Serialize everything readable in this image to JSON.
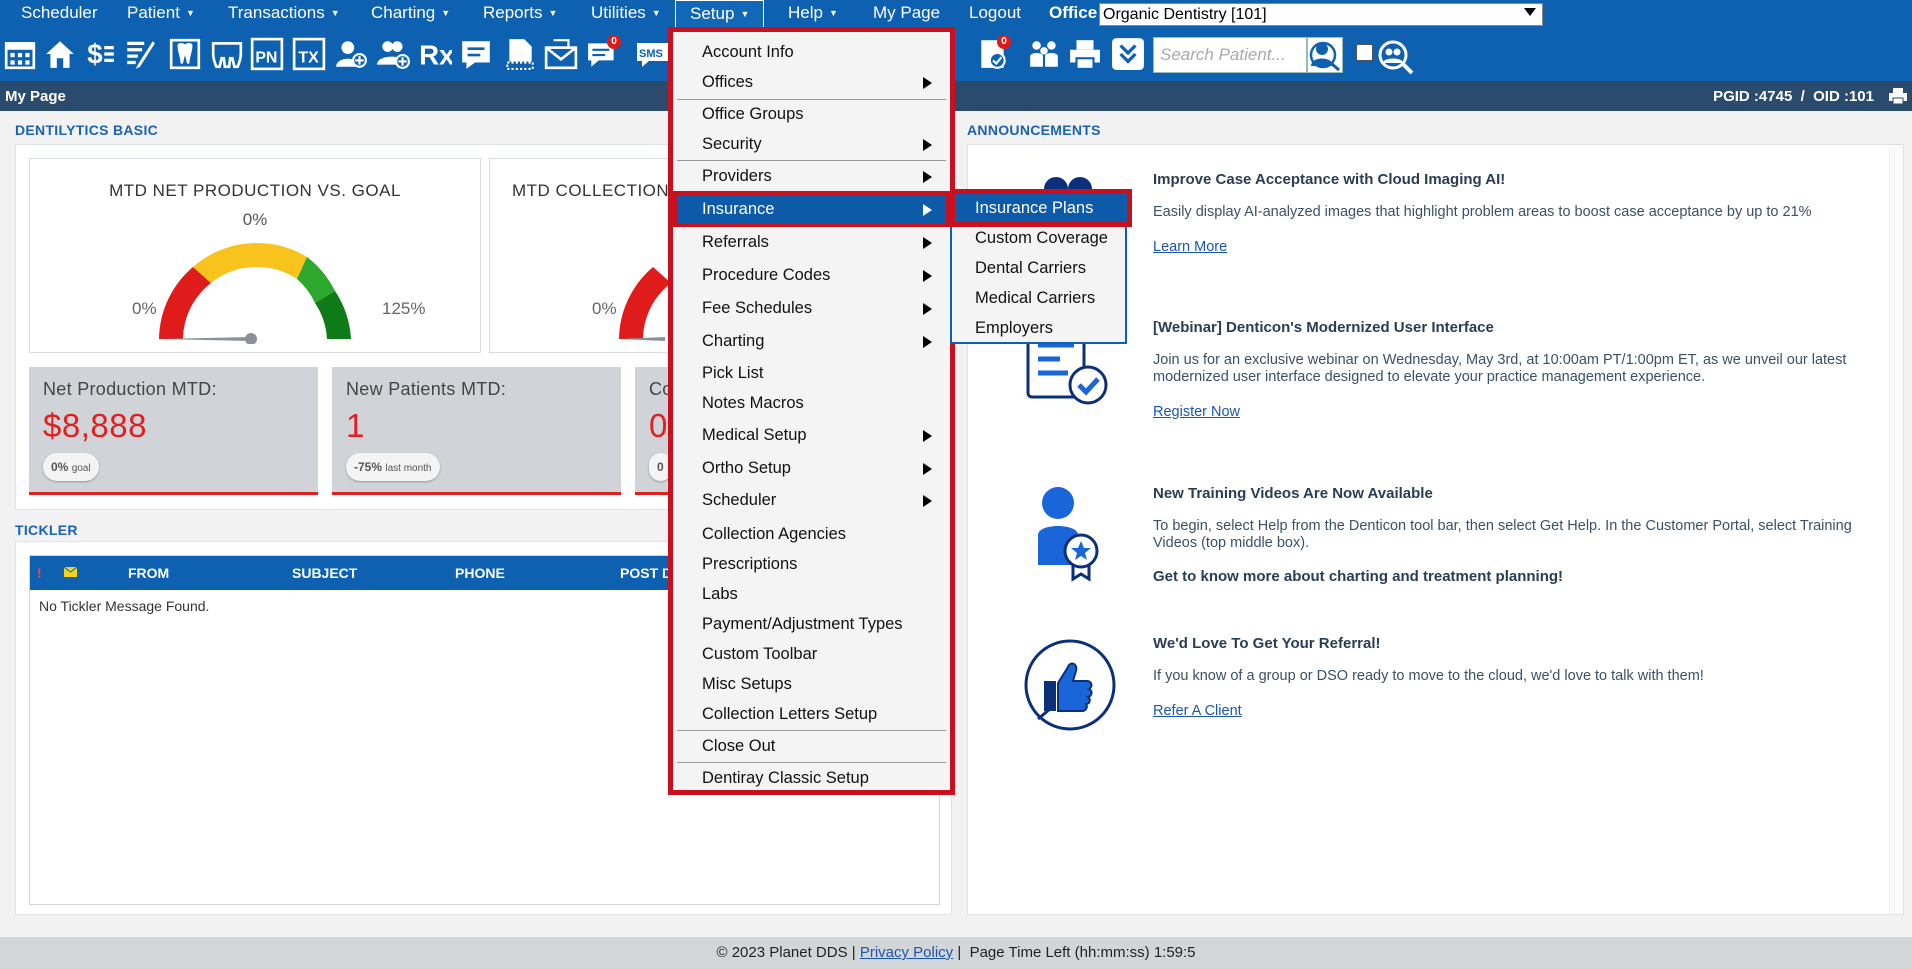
{
  "menubar": {
    "items": [
      {
        "label": "Scheduler",
        "caret": false
      },
      {
        "label": "Patient",
        "caret": true
      },
      {
        "label": "Transactions",
        "caret": true
      },
      {
        "label": "Charting",
        "caret": true
      },
      {
        "label": "Reports",
        "caret": true
      },
      {
        "label": "Utilities",
        "caret": true
      },
      {
        "label": "Setup",
        "caret": true
      },
      {
        "label": "Help",
        "caret": true
      },
      {
        "label": "My Page",
        "caret": false
      },
      {
        "label": "Logout",
        "caret": false
      }
    ],
    "caret_glyph": "▼",
    "office_label": "Office",
    "office_value": "Organic Dentistry [101]"
  },
  "toolbar": {
    "icons": [
      "calendar-icon",
      "home-icon",
      "dollar-transactions-icon",
      "edit-chart-icon",
      "tooth-icon",
      "teeth-icon",
      "progress-notes-icon",
      "treatment-icon",
      "add-patient-icon",
      "add-family-icon",
      "prescription-icon",
      "notes-icon",
      "document-icon",
      "letters-icon",
      "messages-icon",
      "sms-icon",
      "tasks-icon",
      "family-icon",
      "print-icon",
      "collapse-icon"
    ],
    "pn_label": "PN",
    "tx_label": "TX",
    "sms_label": "SMS",
    "rx_label": "Rx",
    "messages_badge": "0",
    "tasks_badge": "0",
    "search_placeholder": "Search Patient..."
  },
  "titlebar": {
    "title": "My Page",
    "pgid": "PGID :4745  /  OID :101"
  },
  "dentilytics": {
    "heading": "DENTILYTICS BASIC",
    "gauges": [
      {
        "title": "MTD NET PRODUCTION VS. GOAL",
        "percent": "0%",
        "min": "0%",
        "max": "125%"
      },
      {
        "title": "MTD COLLECTION",
        "percent": "",
        "min": "0%",
        "max": ""
      }
    ],
    "kpis": [
      {
        "label": "Net Production MTD:",
        "value": "$8,888",
        "chip_value": "0%",
        "chip_note": "goal"
      },
      {
        "label": "New Patients MTD:",
        "value": "1",
        "chip_value": "-75%",
        "chip_note": "last month"
      },
      {
        "label": "Co",
        "value": "0",
        "chip_value": "0",
        "chip_note": ""
      }
    ]
  },
  "tickler": {
    "heading": "TICKLER",
    "flag": "!",
    "columns": [
      "FROM",
      "SUBJECT",
      "PHONE",
      "POST D"
    ],
    "empty_message": "No Tickler Message Found."
  },
  "announcements": {
    "heading": "ANNOUNCEMENTS",
    "items": [
      {
        "title": "Improve Case Acceptance with Cloud Imaging AI!",
        "body": "Easily display AI-analyzed images that highlight problem areas to boost case acceptance by up to 21%",
        "link": "Learn More",
        "image": "ai-imaging-icon"
      },
      {
        "title": "[Webinar] Denticon's Modernized User Interface",
        "body": "Join us for an exclusive webinar on Wednesday, May 3rd, at 10:00am PT/1:00pm ET, as we unveil our latest modernized user interface designed to elevate your practice management experience.",
        "link": "Register Now",
        "image": "checklist-icon"
      },
      {
        "title": "New Training Videos Are Now Available",
        "body": "To begin, select Help from the Denticon tool bar, then select Get Help. In the Customer Portal, select Training Videos (top middle box).",
        "strong": "Get to know more about charting and treatment planning!",
        "image": "certified-user-icon"
      },
      {
        "title": "We'd Love To Get Your Referral!",
        "body": "If you know of a group or DSO ready to move to the cloud, we'd love to talk with them!",
        "link": "Refer A Client",
        "image": "thumbs-up-icon"
      }
    ]
  },
  "setup_menu": {
    "items": [
      {
        "label": "Account Info",
        "submenu": false
      },
      {
        "label": "Offices",
        "submenu": true
      },
      {
        "label": "Office Groups",
        "submenu": false
      },
      {
        "label": "Security",
        "submenu": true
      },
      {
        "label": "Providers",
        "submenu": true
      },
      {
        "label": "Insurance",
        "submenu": true,
        "highlighted": true
      },
      {
        "label": "Referrals",
        "submenu": true
      },
      {
        "label": "Procedure Codes",
        "submenu": true
      },
      {
        "label": "Fee Schedules",
        "submenu": true
      },
      {
        "label": "Charting",
        "submenu": true
      },
      {
        "label": "Pick List",
        "submenu": false
      },
      {
        "label": "Notes Macros",
        "submenu": false
      },
      {
        "label": "Medical Setup",
        "submenu": true
      },
      {
        "label": "Ortho Setup",
        "submenu": true
      },
      {
        "label": "Scheduler",
        "submenu": true
      },
      {
        "label": "Collection Agencies",
        "submenu": false
      },
      {
        "label": "Prescriptions",
        "submenu": false
      },
      {
        "label": "Labs",
        "submenu": false
      },
      {
        "label": "Payment/Adjustment Types",
        "submenu": false
      },
      {
        "label": "Custom Toolbar",
        "submenu": false
      },
      {
        "label": "Misc Setups",
        "submenu": false
      },
      {
        "label": "Collection Letters Setup",
        "submenu": false
      },
      {
        "label": "Close Out",
        "submenu": false
      },
      {
        "label": "Dentiray Classic Setup",
        "submenu": false
      }
    ]
  },
  "insurance_submenu": {
    "items": [
      {
        "label": "Insurance Plans",
        "highlighted": true
      },
      {
        "label": "Custom Coverage"
      },
      {
        "label": "Dental Carriers"
      },
      {
        "label": "Medical Carriers"
      },
      {
        "label": "Employers"
      }
    ]
  },
  "footer": {
    "copyright": "© 2023 Planet DDS | ",
    "privacy": "Privacy Policy",
    "separator": " |  Page Time Left (hh:mm:ss) 1:59:5"
  },
  "colors": {
    "brand_blue": "#0d61b0",
    "highlight_red": "#c8101e",
    "kpi_red": "#e21f1f",
    "title_strip": "#2a4a6e"
  }
}
